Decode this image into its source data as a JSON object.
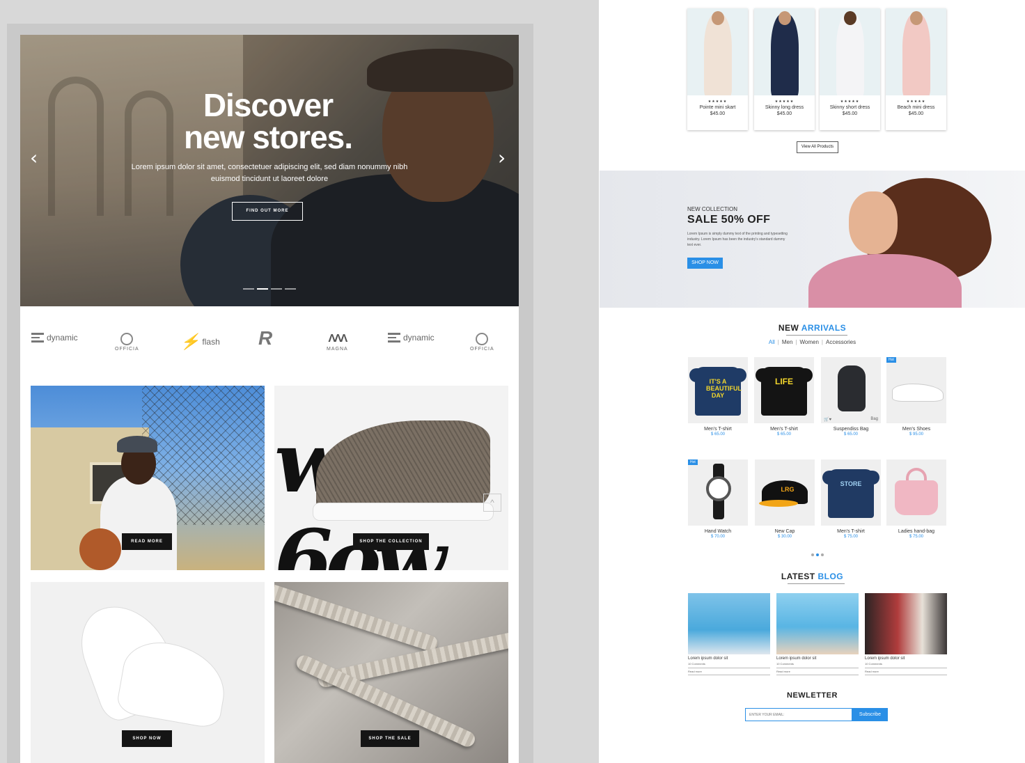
{
  "left": {
    "hero": {
      "title_line1": "Discover",
      "title_line2": "new stores.",
      "subtitle": "Lorem ipsum dolor sit amet, consectetuer adipiscing elit, sed diam nonummy nibh euismod tincidunt ut laoreet dolore",
      "button": "FIND OUT MORE",
      "prev_icon": "chevron-left-icon",
      "next_icon": "chevron-right-icon"
    },
    "brands": [
      "dynamic",
      "OFFICIA",
      "flash",
      "R",
      "MAGNA",
      "dynamic",
      "OFFICIA"
    ],
    "tiles": [
      {
        "button": "READ MORE"
      },
      {
        "button": "SHOP THE COLLECTION"
      },
      {
        "button": "SHOP NOW"
      },
      {
        "button": "SHOP THE SALE"
      }
    ]
  },
  "right": {
    "top_products": [
      {
        "stars": "★★★★★",
        "name": "Pointe mini skart",
        "price": "$45.00",
        "color": "#f0e2d6"
      },
      {
        "stars": "★★★★★",
        "name": "Skinny long dress",
        "price": "$45.00",
        "color": "#1f2c4a"
      },
      {
        "stars": "★★★★★",
        "name": "Skinny short dress",
        "price": "$45.00",
        "color": "#f4f4f6"
      },
      {
        "stars": "★★★★★",
        "name": "Beach mini dress",
        "price": "$45.00",
        "color": "#f2c9c4"
      }
    ],
    "view_all": "View All Products",
    "banner": {
      "kicker": "NEW COLLECTION",
      "title": "SALE 50% OFF",
      "text": "Lorem Ipsum is simply dummy text of the printing and typesetting industry. Lorem Ipsum has been the industry's standard dummy text ever.",
      "button": "SHOP NOW"
    },
    "arrivals": {
      "title_a": "NEW ",
      "title_b": "ARRIVALS",
      "filters": [
        "All",
        "Men",
        "Women",
        "Accessories"
      ],
      "hot_label": "Hot",
      "bag_label": "Bag",
      "items": [
        {
          "name": "Men's T-shirt",
          "price": "$ 65.00"
        },
        {
          "name": "Men's T-shirt",
          "price": "$ 65.00"
        },
        {
          "name": "Suspendiss Bag",
          "price": "$ 65.00"
        },
        {
          "name": "Men's Shoes",
          "price": "$ 95.00"
        },
        {
          "name": "Hand Watch",
          "price": "$ 70.00"
        },
        {
          "name": "New Cap",
          "price": "$ 30.00"
        },
        {
          "name": "Men's T-shirt",
          "price": "$ 75.00"
        },
        {
          "name": "Ladies hand-bag",
          "price": "$ 75.00"
        }
      ],
      "tee1_print": "IT'S A BEAUTIFUL DAY",
      "tee2_print": "LIFE",
      "cap_print": "LRG",
      "tee3_print": "STORE"
    },
    "blog": {
      "title_a": "LATEST ",
      "title_b": "BLOG",
      "posts": [
        {
          "title": "Lorem ipsum dolor sit",
          "comments": "10 Comments",
          "more": "Read more"
        },
        {
          "title": "Lorem ipsum dolor sit",
          "comments": "10 Comments",
          "more": "Read more"
        },
        {
          "title": "Lorem ipsum dolor sit",
          "comments": "10 Comments",
          "more": "Read more"
        }
      ]
    },
    "newsletter": {
      "title": "NEWLETTER",
      "placeholder": "ENTER YOUR EMAIL:",
      "button": "Subscribe"
    }
  },
  "colors": {
    "accent": "#2a8fe6",
    "dark_button": "#151515"
  }
}
